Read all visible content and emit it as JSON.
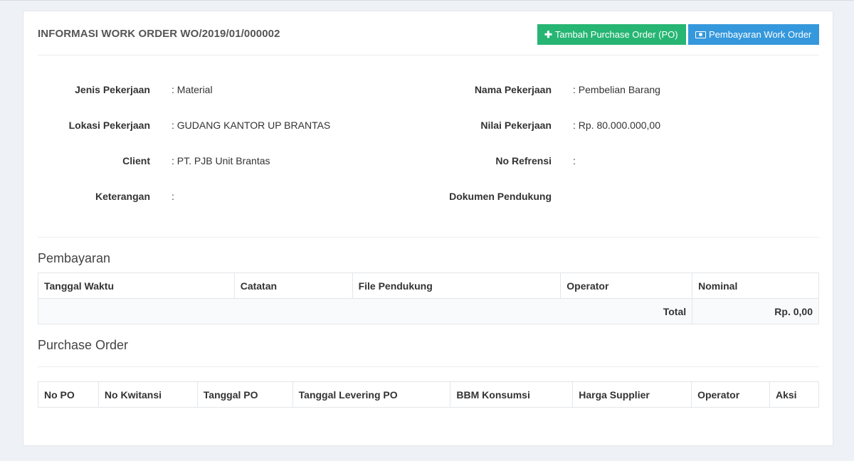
{
  "header": {
    "title": "INFORMASI WORK ORDER WO/2019/01/000002",
    "btn_add_po": "Tambah Purchase Order (PO)",
    "btn_payment": "Pembayaran Work Order"
  },
  "info": {
    "jenis_label": "Jenis Pekerjaan",
    "jenis_value": ": Material",
    "lokasi_label": "Lokasi Pekerjaan",
    "lokasi_value": ": GUDANG KANTOR UP BRANTAS",
    "client_label": "Client",
    "client_value": ": PT. PJB Unit Brantas",
    "keterangan_label": "Keterangan",
    "keterangan_value": ":",
    "nama_label": "Nama Pekerjaan",
    "nama_value": ": Pembelian Barang",
    "nilai_label": "Nilai Pekerjaan",
    "nilai_value": ": Rp. 80.000.000,00",
    "refrensi_label": "No Refrensi",
    "refrensi_value": ":",
    "dokumen_label": "Dokumen Pendukung"
  },
  "pembayaran": {
    "title": "Pembayaran",
    "columns": [
      "Tanggal Waktu",
      "Catatan",
      "File Pendukung",
      "Operator",
      "Nominal"
    ],
    "total_label": "Total",
    "total_value": "Rp. 0,00"
  },
  "purchase_order": {
    "title": "Purchase Order",
    "columns": [
      "No PO",
      "No Kwitansi",
      "Tanggal PO",
      "Tanggal Levering PO",
      "BBM Konsumsi",
      "Harga Supplier",
      "Operator",
      "Aksi"
    ]
  }
}
